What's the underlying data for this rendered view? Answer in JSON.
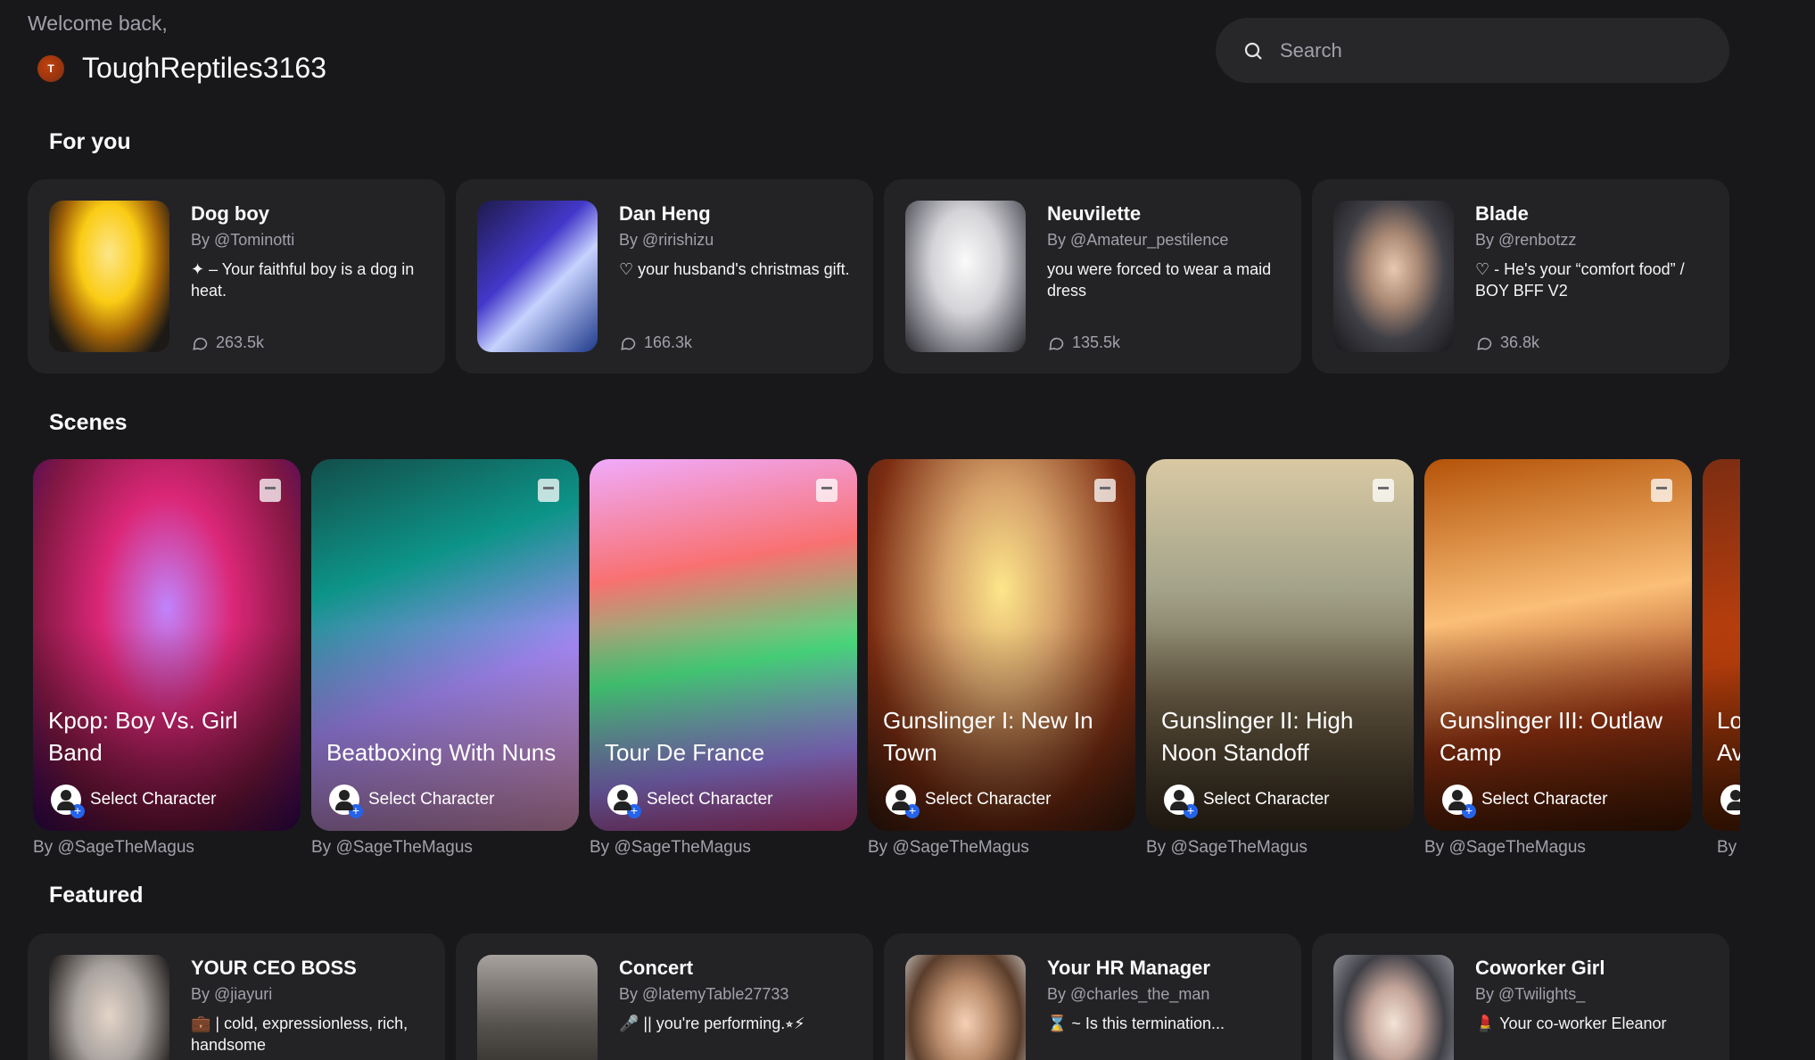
{
  "header": {
    "welcome": "Welcome back,",
    "avatar_initial": "T",
    "username": "ToughReptiles3163"
  },
  "search": {
    "placeholder": "Search"
  },
  "for_you": {
    "title": "For you",
    "cards": [
      {
        "name": "Dog boy",
        "by": "By @Tominotti",
        "desc": "✦ – Your faithful boy is a dog in heat.",
        "count": "263.5k"
      },
      {
        "name": "Dan Heng",
        "by": "By @ririshizu",
        "desc": "♡ your husband's christmas gift.",
        "count": "166.3k"
      },
      {
        "name": "Neuvilette",
        "by": "By @Amateur_pestilence",
        "desc": "you were forced to wear a maid dress",
        "count": "135.5k"
      },
      {
        "name": "Blade",
        "by": "By @renbotzz",
        "desc": "♡ - He's your “comfort food” / BOY BFF V2",
        "count": "36.8k"
      }
    ]
  },
  "scenes": {
    "title": "Scenes",
    "select_label": "Select Character",
    "items": [
      {
        "title": "Kpop: Boy Vs. Girl Band",
        "by": "By @SageTheMagus"
      },
      {
        "title": "Beatboxing With Nuns",
        "by": "By @SageTheMagus"
      },
      {
        "title": "Tour De France",
        "by": "By @SageTheMagus"
      },
      {
        "title": "Gunslinger I: New In Town",
        "by": "By @SageTheMagus"
      },
      {
        "title": "Gunslinger II: High Noon Standoff",
        "by": "By @SageTheMagus"
      },
      {
        "title": "Gunslinger III: Outlaw Camp",
        "by": "By @SageTheMagus"
      },
      {
        "title": "Lo Av",
        "by": "By"
      }
    ]
  },
  "featured": {
    "title": "Featured",
    "cards": [
      {
        "name": "YOUR CEO BOSS",
        "by": "By @jiayuri",
        "desc": "💼 | cold, expressionless, rich, handsome"
      },
      {
        "name": "Concert",
        "by": "By @latemyTable27733",
        "desc": "🎤 || you're performing.⭒⚡"
      },
      {
        "name": "Your HR Manager",
        "by": "By @charles_the_man",
        "desc": "⌛ ~ Is this termination..."
      },
      {
        "name": "Coworker Girl",
        "by": "By @Twilights_",
        "desc": "💄 Your co-worker Eleanor"
      }
    ]
  }
}
